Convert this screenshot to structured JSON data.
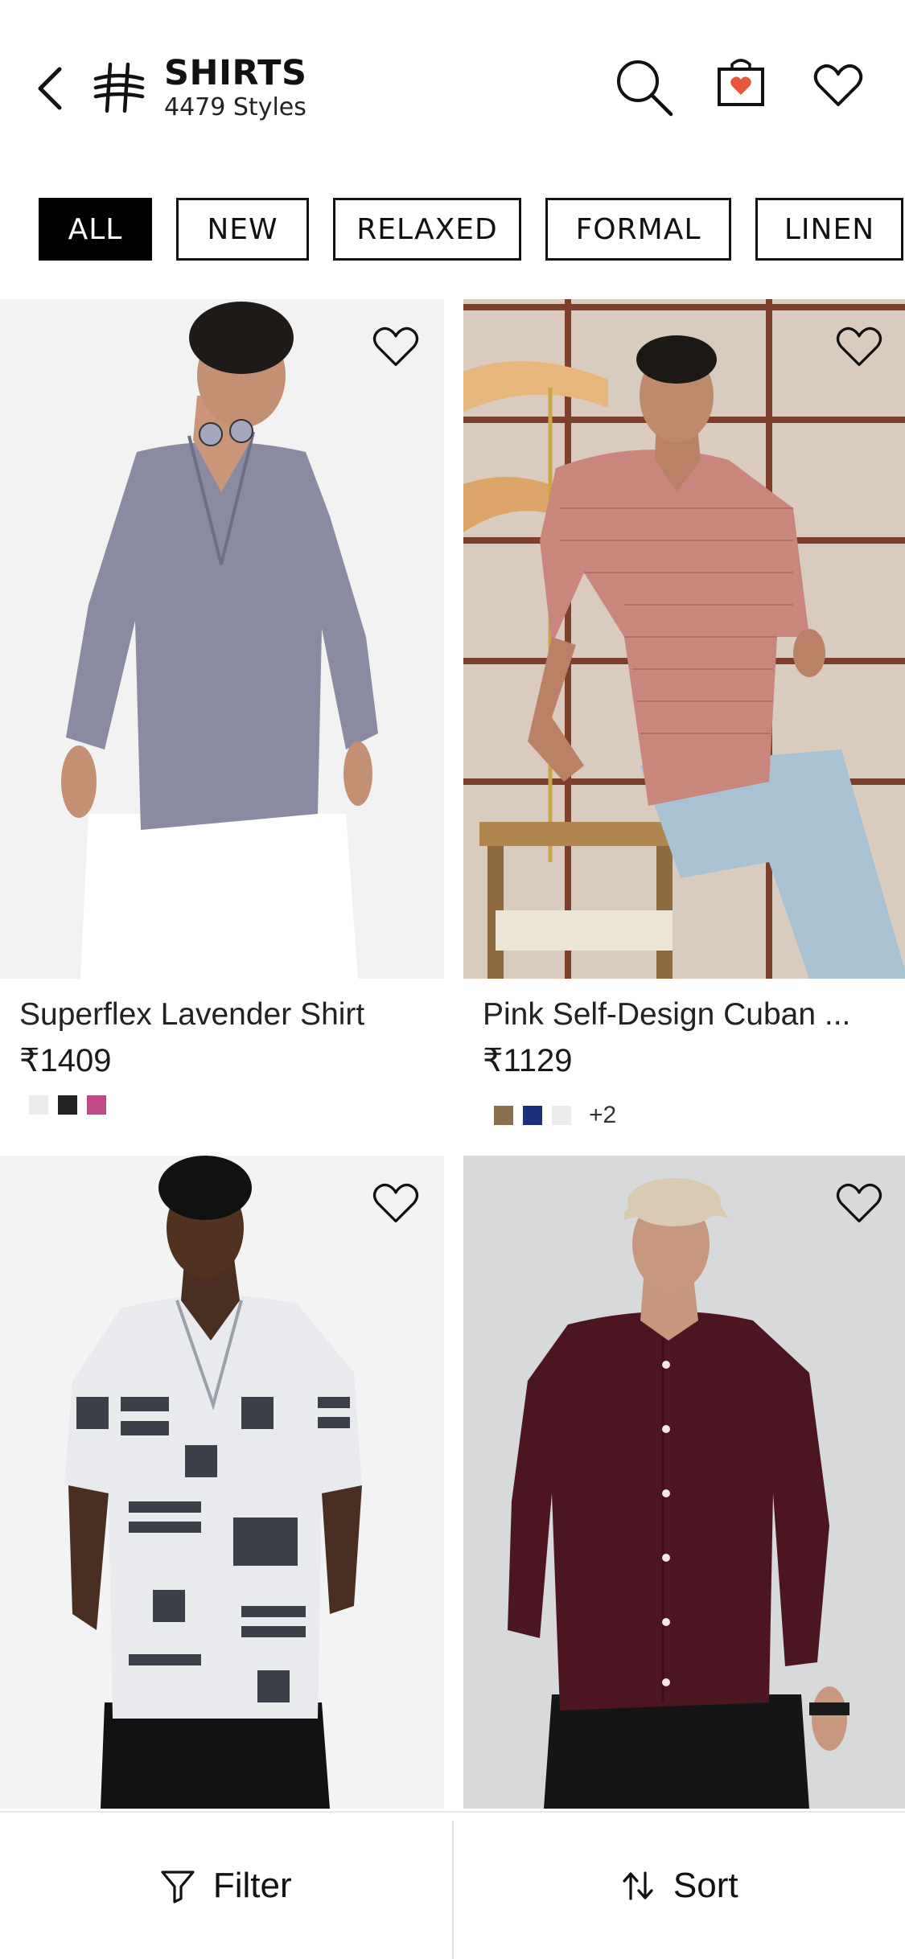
{
  "header": {
    "title": "SHIRTS",
    "subtitle": "4479 Styles",
    "icons": {
      "back": "chevron-left-icon",
      "logo": "brand-logo-icon",
      "search": "search-icon",
      "bag": "shopping-bag-icon",
      "wishlist": "heart-icon"
    },
    "bag_accent": "#e4573d"
  },
  "chips": [
    {
      "label": "ALL",
      "active": true
    },
    {
      "label": "NEW",
      "active": false
    },
    {
      "label": "RELAXED",
      "active": false
    },
    {
      "label": "FORMAL",
      "active": false
    },
    {
      "label": "LINEN",
      "active": false
    }
  ],
  "products": [
    {
      "name": "Superflex Lavender Shirt",
      "price": "₹1409",
      "swatches": [
        "#ececec",
        "#222222",
        "#c04a88"
      ],
      "more": ""
    },
    {
      "name": "Pink Self-Design Cuban ...",
      "price": "₹1129",
      "swatches": [
        "#8b6e4e",
        "#1c2f7a",
        "#ececec"
      ],
      "more": "+2"
    },
    {
      "name": "",
      "price": "",
      "swatches": [],
      "more": ""
    },
    {
      "name": "",
      "price": "",
      "swatches": [],
      "more": ""
    }
  ],
  "bottom_bar": {
    "filter_label": "Filter",
    "sort_label": "Sort",
    "icons": {
      "filter": "funnel-icon",
      "sort": "sort-arrows-icon"
    }
  }
}
